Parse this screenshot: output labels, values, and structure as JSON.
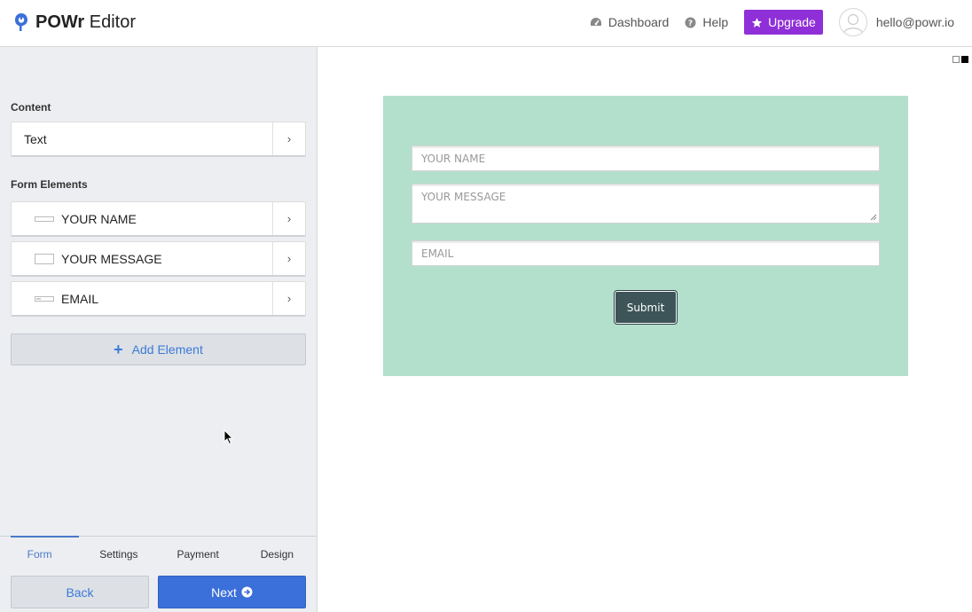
{
  "header": {
    "brand_bold": "POWr",
    "brand_rest": " Editor",
    "nav": {
      "dashboard": "Dashboard",
      "help": "Help",
      "upgrade": "Upgrade",
      "account_email": "hello@powr.io"
    }
  },
  "sidebar": {
    "content_heading": "Content",
    "content_items": [
      {
        "label": "Text",
        "icon": "chevron-right-icon"
      }
    ],
    "form_elements_heading": "Form Elements",
    "form_elements": [
      {
        "label": "YOUR NAME",
        "icon": "text-field-icon"
      },
      {
        "label": "YOUR MESSAGE",
        "icon": "textarea-icon"
      },
      {
        "label": "EMAIL",
        "icon": "email-field-icon"
      }
    ],
    "add_element_label": "Add Element",
    "tabs": [
      {
        "label": "Form",
        "active": true
      },
      {
        "label": "Settings",
        "active": false
      },
      {
        "label": "Payment",
        "active": false
      },
      {
        "label": "Design",
        "active": false
      }
    ],
    "back_label": "Back",
    "next_label": "Next"
  },
  "preview": {
    "form": {
      "background": "#b3e0cc",
      "name_placeholder": "YOUR NAME",
      "message_placeholder": "YOUR MESSAGE",
      "email_placeholder": "EMAIL",
      "submit_label": "Submit"
    }
  },
  "colors": {
    "accent": "#3b6fd9",
    "upgrade": "#8f2fd8",
    "submit": "#3d5458"
  }
}
